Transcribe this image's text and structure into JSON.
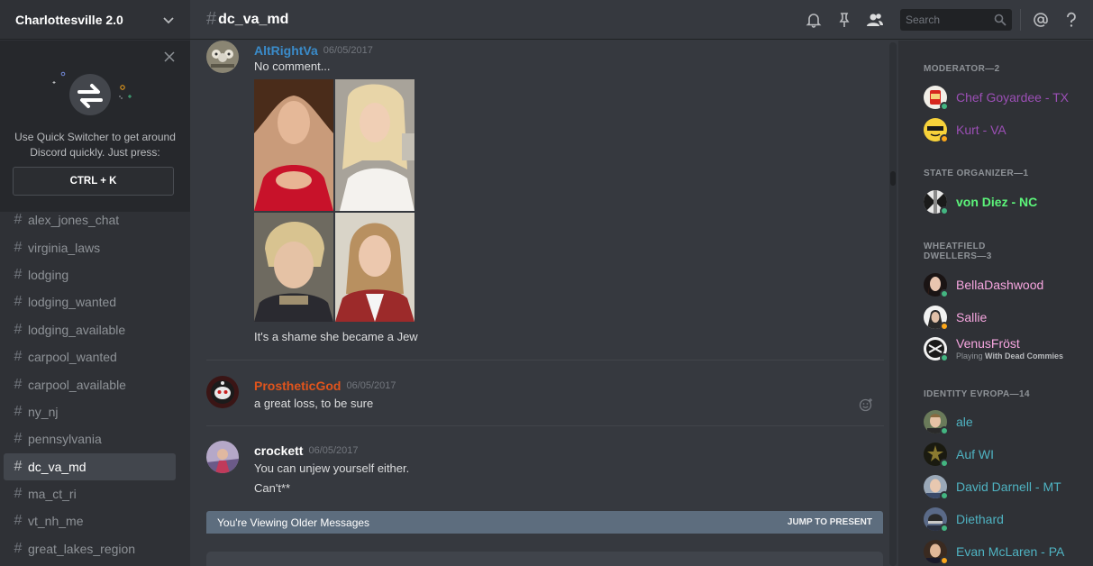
{
  "server": {
    "name": "Charlottesville 2.0"
  },
  "quick_switcher": {
    "text": "Use Quick Switcher to get around Discord quickly. Just press:",
    "key": "CTRL + K"
  },
  "channels": [
    {
      "name": "alex_jones_chat"
    },
    {
      "name": "virginia_laws"
    },
    {
      "name": "lodging"
    },
    {
      "name": "lodging_wanted"
    },
    {
      "name": "lodging_available"
    },
    {
      "name": "carpool_wanted"
    },
    {
      "name": "carpool_available"
    },
    {
      "name": "ny_nj"
    },
    {
      "name": "pennsylvania"
    },
    {
      "name": "dc_va_md"
    },
    {
      "name": "ma_ct_ri"
    },
    {
      "name": "vt_nh_me"
    },
    {
      "name": "great_lakes_region"
    }
  ],
  "active_channel": "dc_va_md",
  "header": {
    "hash": "#",
    "channel": "dc_va_md",
    "search_placeholder": "Search",
    "icons": [
      "bell-icon",
      "pin-icon",
      "members-icon",
      "search-icon",
      "mention-icon",
      "help-icon"
    ]
  },
  "messages": [
    {
      "author": "AltRightVa",
      "color": "#3a8bc9",
      "time": "06/05/2017",
      "lines": [
        "No comment...",
        "It's a shame she became a Jew"
      ]
    },
    {
      "author": "ProstheticGod",
      "color": "#e0541c",
      "time": "06/05/2017",
      "lines": [
        "a great loss, to be sure"
      ]
    },
    {
      "author": "crockett",
      "color": "#ffffff",
      "time": "06/05/2017",
      "lines": [
        "You can unjew yourself either.",
        "Can't**"
      ]
    }
  ],
  "older_bar": {
    "text": "You're Viewing Older Messages",
    "jump": "JUMP TO PRESENT"
  },
  "members": {
    "roles": [
      {
        "label": "MODERATOR—2"
      },
      {
        "label": "STATE ORGANIZER—1"
      },
      {
        "label": "WHEATFIELD DWELLERS—3"
      },
      {
        "label": "IDENTITY EVROPA—14"
      }
    ],
    "list": [
      {
        "name": "Chef Goyardee - TX",
        "color": "#9b4fb5",
        "status": "#43b581"
      },
      {
        "name": "Kurt - VA",
        "color": "#9b4fb5",
        "status": "#faa61a"
      },
      {
        "name": "von Diez - NC",
        "color": "#5cf47a",
        "status": "#43b581"
      },
      {
        "name": "BellaDashwood",
        "color": "#f7a6e0",
        "status": "#43b581"
      },
      {
        "name": "Sallie",
        "color": "#f7a6e0",
        "status": "#faa61a"
      },
      {
        "name": "VenusFröst",
        "color": "#f7a6e0",
        "status": "#43b581",
        "activity_prefix": "Playing",
        "activity_game": "With Dead Commies"
      },
      {
        "name": "ale",
        "color": "#4fb3c2",
        "status": "#43b581"
      },
      {
        "name": "Auf WI",
        "color": "#4fb3c2",
        "status": "#43b581"
      },
      {
        "name": "David Darnell - MT",
        "color": "#4fb3c2",
        "status": "#43b581"
      },
      {
        "name": "Diethard",
        "color": "#4fb3c2",
        "status": "#43b581"
      },
      {
        "name": "Evan McLaren - PA",
        "color": "#4fb3c2",
        "status": "#faa61a"
      }
    ]
  }
}
